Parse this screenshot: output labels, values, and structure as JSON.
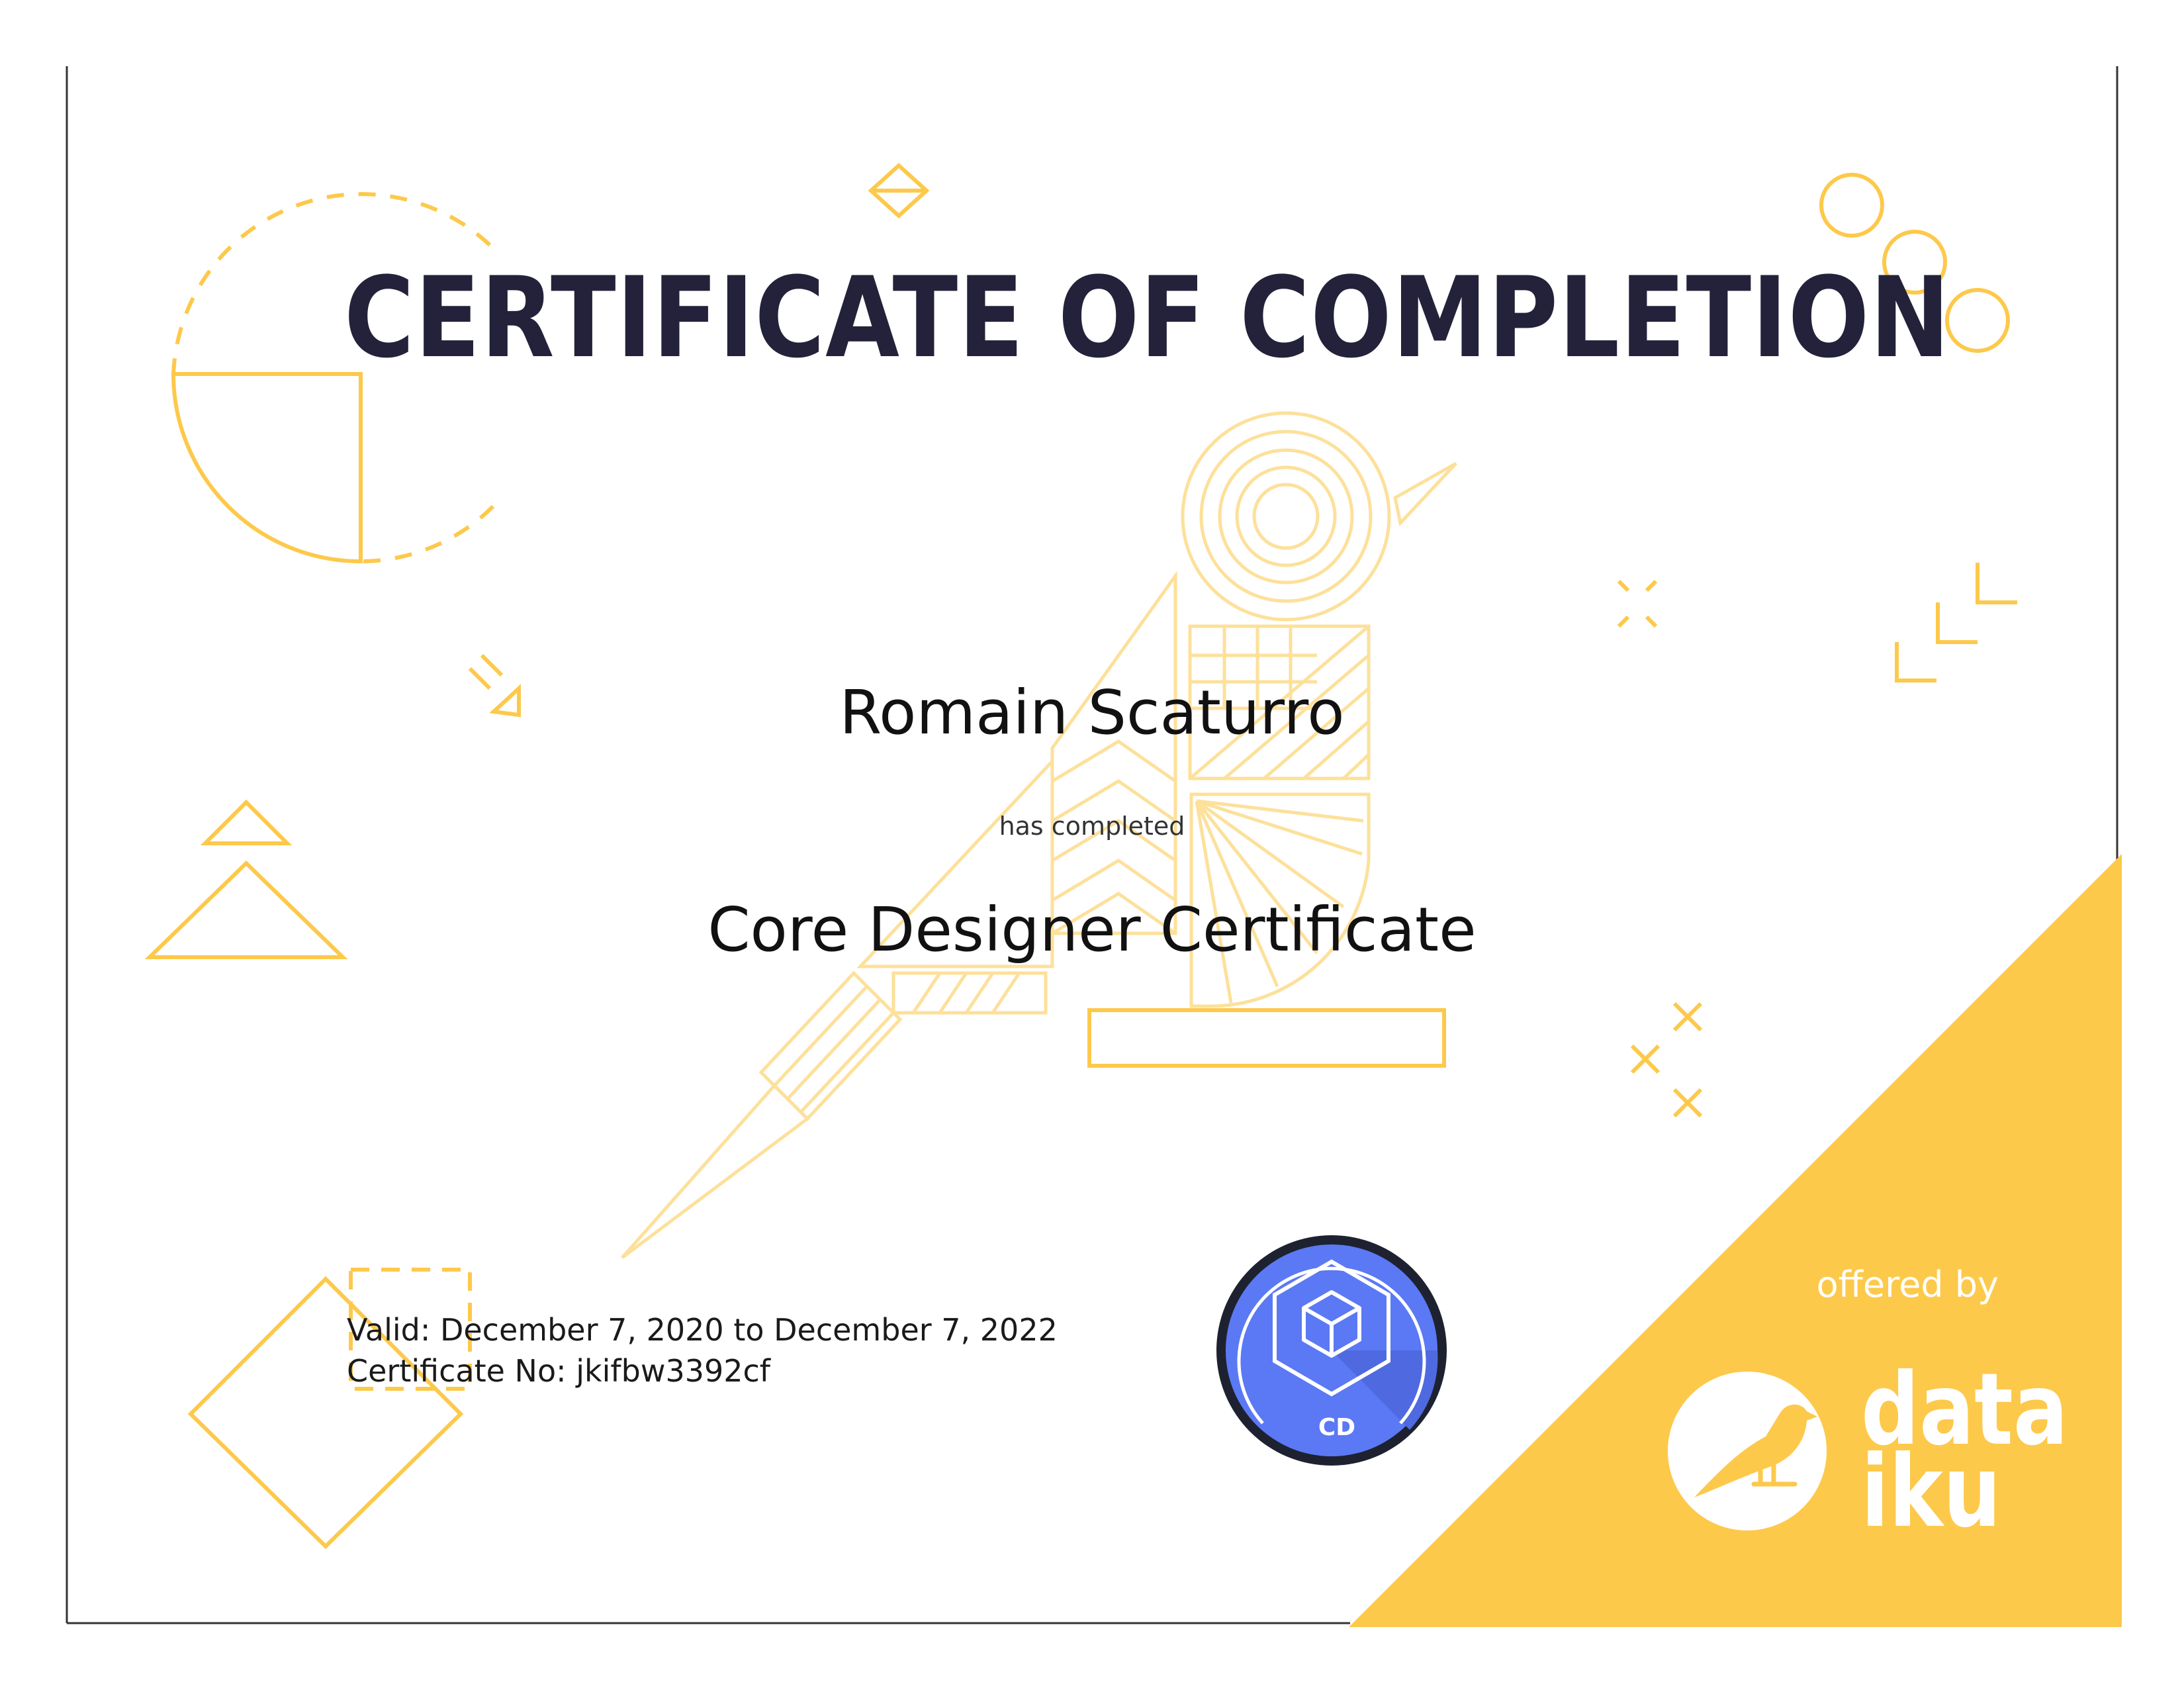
{
  "certificate": {
    "title": "CERTIFICATE OF COMPLETION",
    "recipient_name": "Romain Scaturro",
    "completed_label": "has completed",
    "course_name": "Core Designer Certificate",
    "valid_text": "Valid: December 7, 2020 to December 7, 2022",
    "certificate_no_text": "Certificate No: jkifbw3392cf"
  },
  "badge": {
    "code": "CD",
    "icon": "cube-icon"
  },
  "branding": {
    "offered_by": "offered by",
    "logo_line_1": "data",
    "logo_line_2": "iku",
    "logo_icon": "bird-icon"
  },
  "colors": {
    "accent_yellow": "#fdc94b",
    "title_navy": "#23223a",
    "badge_blue": "#5b79f4",
    "badge_dark": "#1e2230"
  }
}
